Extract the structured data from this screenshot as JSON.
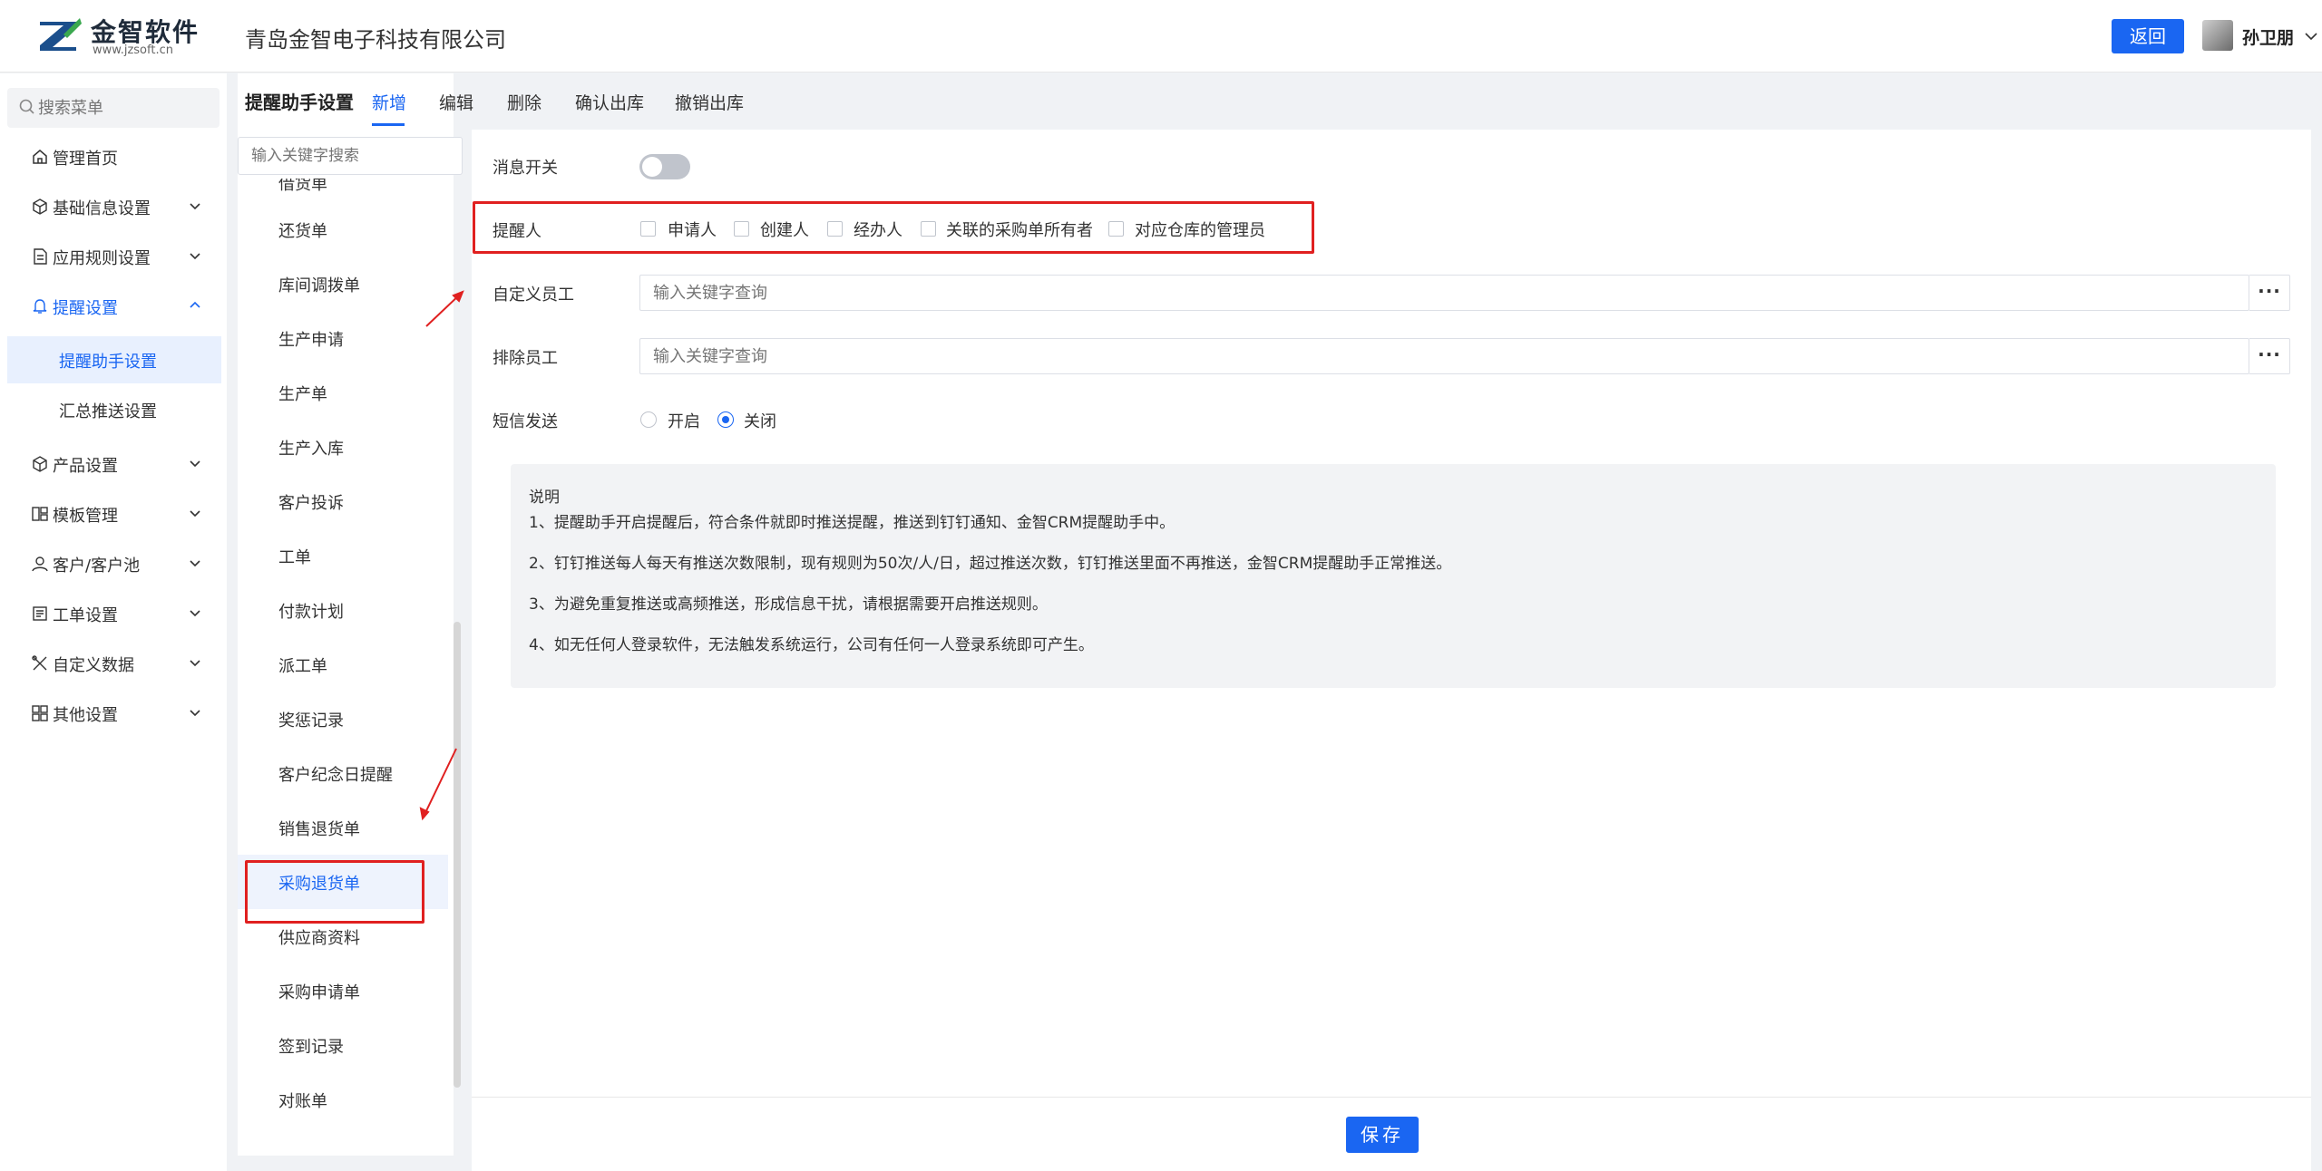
{
  "header": {
    "logo_text": "金智软件",
    "logo_url": "www.jzsoft.cn",
    "company": "青岛金智电子科技有限公司",
    "back_label": "返回",
    "user_name": "孙卫朋"
  },
  "sidebar": {
    "search_placeholder": "搜索菜单",
    "items": [
      {
        "label": "管理首页",
        "icon": "home-icon"
      },
      {
        "label": "基础信息设置",
        "icon": "cube-icon"
      },
      {
        "label": "应用规则设置",
        "icon": "document-icon"
      },
      {
        "label": "提醒设置",
        "icon": "bell-icon"
      },
      {
        "label": "产品设置",
        "icon": "cube-icon"
      },
      {
        "label": "模板管理",
        "icon": "template-icon"
      },
      {
        "label": "客户/客户池",
        "icon": "user-icon"
      },
      {
        "label": "工单设置",
        "icon": "ticket-icon"
      },
      {
        "label": "自定义数据",
        "icon": "tools-icon"
      },
      {
        "label": "其他设置",
        "icon": "grid-icon"
      }
    ],
    "sub_items": [
      "提醒助手设置",
      "汇总推送设置"
    ]
  },
  "list": {
    "title": "提醒助手设置",
    "search_placeholder": "输入关键字搜索",
    "partial_top": "借货单",
    "items": [
      "还货单",
      "库间调拨单",
      "生产申请",
      "生产单",
      "生产入库",
      "客户投诉",
      "工单",
      "付款计划",
      "派工单",
      "奖惩记录",
      "客户纪念日提醒",
      "销售退货单",
      "采购退货单",
      "供应商资料",
      "采购申请单",
      "签到记录",
      "对账单"
    ],
    "selected": "采购退货单"
  },
  "tabs": [
    "新增",
    "编辑",
    "删除",
    "确认出库",
    "撤销出库"
  ],
  "form": {
    "msg_switch_label": "消息开关",
    "msg_switch_on": false,
    "reminder_label": "提醒人",
    "reminder_options": [
      "申请人",
      "创建人",
      "经办人",
      "关联的采购单所有者",
      "对应仓库的管理员"
    ],
    "custom_staff_label": "自定义员工",
    "custom_staff_placeholder": "输入关键字查询",
    "exclude_staff_label": "排除员工",
    "exclude_staff_placeholder": "输入关键字查询",
    "dots": "···",
    "sms_label": "短信发送",
    "sms_options": [
      "开启",
      "关闭"
    ],
    "sms_selected": "关闭"
  },
  "note": {
    "title": "说明",
    "lines": [
      "1、提醒助手开启提醒后，符合条件就即时推送提醒，推送到钉钉通知、金智CRM提醒助手中。",
      "2、钉钉推送每人每天有推送次数限制，现有规则为50次/人/日，超过推送次数，钉钉推送里面不再推送，金智CRM提醒助手正常推送。",
      "3、为避免重复推送或高频推送，形成信息干扰，请根据需要开启推送规则。",
      "4、如无任何人登录软件，无法触发系统运行，公司有任何一人登录系统即可产生。"
    ]
  },
  "footer": {
    "save_label": "保存"
  },
  "colors": {
    "accent": "#1a66f2",
    "highlight": "#e02020"
  }
}
